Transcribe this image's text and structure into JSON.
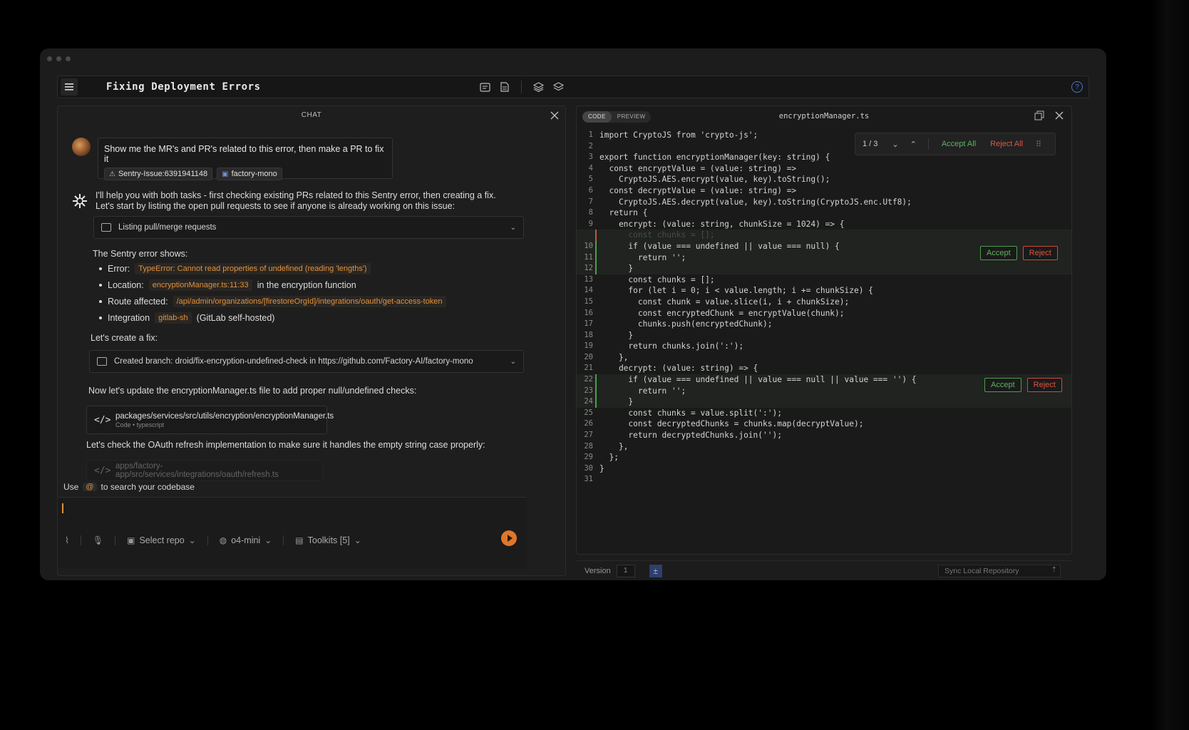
{
  "window": {
    "title": "Fixing Deployment Errors"
  },
  "chat": {
    "header": "CHAT",
    "user_message": "Show me the MR's and PR's related to this error, then make a PR to fix it",
    "chips": [
      "Sentry-Issue:6391941148",
      "factory-mono"
    ],
    "ai_intro_1": "I'll help you with both tasks - first checking existing PRs related to this Sentry error, then creating a fix.",
    "ai_intro_2": "Let's start by listing the open pull requests to see if anyone is already working on this issue:",
    "tool_1": "Listing pull/merge requests",
    "sentry_heading": "The Sentry error shows:",
    "bullets": [
      {
        "label": "Error:",
        "tag": "TypeError: Cannot read properties of undefined (reading 'lengths')",
        "suffix": ""
      },
      {
        "label": "Location:",
        "tag": "encryptionManager.ts:11:33",
        "suffix": "in the encryption function"
      },
      {
        "label": "Route affected:",
        "tag": "/api/admin/organizations/[firestoreOrgId]/integrations/oauth/get-access-token",
        "suffix": ""
      },
      {
        "label": "Integration",
        "tag": "gitlab-sh",
        "suffix": "(GitLab self-hosted)"
      }
    ],
    "fix_heading": "Let's create a fix:",
    "tool_2": "Created branch: droid/fix-encryption-undefined-check in https://github.com/Factory-AI/factory-mono",
    "update_text": "Now let's update the encryptionManager.ts file to add proper null/undefined checks:",
    "file_card": {
      "path": "packages/services/src/utils/encryption/encryptionManager.ts",
      "meta": "Code • typescript"
    },
    "oauth_text": "Let's check the OAuth refresh implementation to make sure it handles the empty string case properly:",
    "faded_file": "apps/factory-app/src/services/integrations/oauth/refresh.ts",
    "hint_prefix": "Use",
    "hint_at": "@",
    "hint_suffix": "to search your codebase",
    "composer": {
      "repo": "Select repo",
      "model": "o4-mini",
      "toolkits": "Toolkits [5]"
    }
  },
  "code": {
    "tabs": [
      "CODE",
      "PREVIEW"
    ],
    "filename": "encryptionManager.ts",
    "review": {
      "count": "1 / 3",
      "accept_all": "Accept All",
      "reject_all": "Reject All"
    },
    "accept_label": "Accept",
    "reject_label": "Reject",
    "lines": [
      {
        "n": "1",
        "t": "import CryptoJS from 'crypto-js';"
      },
      {
        "n": "2",
        "t": ""
      },
      {
        "n": "3",
        "t": "export function encryptionManager(key: string) {"
      },
      {
        "n": "4",
        "t": "  const encryptValue = (value: string) =>"
      },
      {
        "n": "5",
        "t": "    CryptoJS.AES.encrypt(value, key).toString();"
      },
      {
        "n": "6",
        "t": "  const decryptValue = (value: string) =>"
      },
      {
        "n": "7",
        "t": "    CryptoJS.AES.decrypt(value, key).toString(CryptoJS.enc.Utf8);"
      },
      {
        "n": "8",
        "t": "  return {"
      },
      {
        "n": "9",
        "t": "    encrypt: (value: string, chunkSize = 1024) => {"
      },
      {
        "n": "",
        "t": "      const chunks = [];"
      },
      {
        "n": "10",
        "t": "      if (value === undefined || value === null) {"
      },
      {
        "n": "11",
        "t": "        return '';"
      },
      {
        "n": "12",
        "t": "      }"
      },
      {
        "n": "13",
        "t": "      const chunks = [];"
      },
      {
        "n": "14",
        "t": "      for (let i = 0; i < value.length; i += chunkSize) {"
      },
      {
        "n": "15",
        "t": "        const chunk = value.slice(i, i + chunkSize);"
      },
      {
        "n": "16",
        "t": "        const encryptedChunk = encryptValue(chunk);"
      },
      {
        "n": "17",
        "t": "        chunks.push(encryptedChunk);"
      },
      {
        "n": "18",
        "t": "      }"
      },
      {
        "n": "19",
        "t": "      return chunks.join(':');"
      },
      {
        "n": "20",
        "t": "    },"
      },
      {
        "n": "21",
        "t": "    decrypt: (value: string) => {"
      },
      {
        "n": "22",
        "t": "      if (value === undefined || value === null || value === '') {"
      },
      {
        "n": "23",
        "t": "        return '';"
      },
      {
        "n": "24",
        "t": "      }"
      },
      {
        "n": "25",
        "t": "      const chunks = value.split(':');"
      },
      {
        "n": "26",
        "t": "      const decryptedChunks = chunks.map(decryptValue);"
      },
      {
        "n": "27",
        "t": "      return decryptedChunks.join('');"
      },
      {
        "n": "28",
        "t": "    },"
      },
      {
        "n": "29",
        "t": "  };"
      },
      {
        "n": "30",
        "t": "}"
      },
      {
        "n": "31",
        "t": ""
      }
    ],
    "footer": {
      "version_label": "Version",
      "version_value": "1",
      "sync": "Sync Local Repository"
    }
  }
}
